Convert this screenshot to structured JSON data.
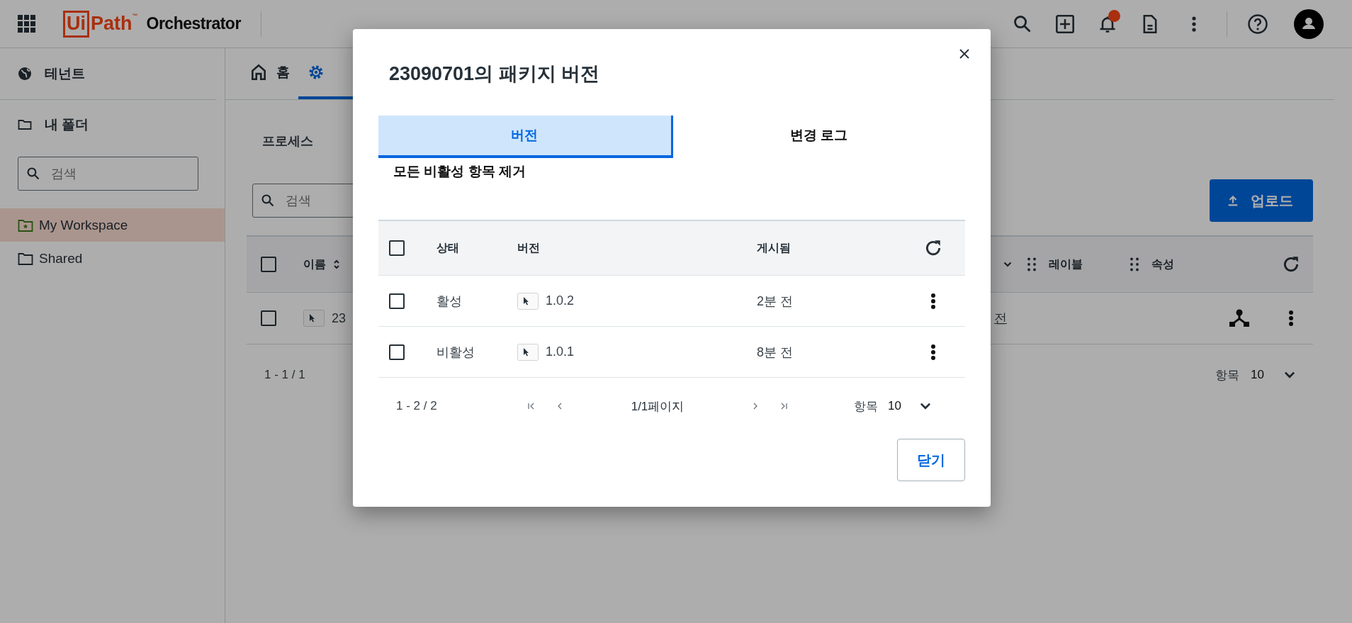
{
  "top_bar": {
    "logo": {
      "boxed": "Ui",
      "rest": "Path",
      "tm": "™"
    },
    "product": "Orchestrator",
    "notification_badge": true
  },
  "sidebar": {
    "tenant": "테넌트",
    "my_folder": "내 폴더",
    "search": {
      "placeholder": "검색"
    },
    "folders": [
      {
        "label": "My Workspace",
        "kind": "personal",
        "selected": true
      },
      {
        "label": "Shared",
        "kind": "folder",
        "selected": false
      }
    ]
  },
  "main": {
    "tabs": [
      {
        "kind": "home",
        "label": "홈",
        "selected": false
      },
      {
        "kind": "gear",
        "selected": true
      }
    ],
    "section": "프로세스",
    "search": {
      "placeholder": "검색"
    },
    "upload_button": "업로드",
    "table": {
      "header_checked": false,
      "columns": [
        {
          "kind": "sortable",
          "label": "이름"
        },
        {
          "kind": "dropdown"
        },
        {
          "kind": "draggable",
          "label": "레이블"
        },
        {
          "kind": "draggable",
          "label": "속성"
        }
      ],
      "rows": [
        {
          "checked": false,
          "name": "23",
          "column_2": "전"
        }
      ]
    },
    "pagination": {
      "range": "1 - 1 / 1",
      "items_label": "항목",
      "page_size": "10"
    }
  },
  "dialog": {
    "title": "23090701의 패키지 버전",
    "tabs": [
      {
        "label": "버전",
        "selected": true
      },
      {
        "label": "변경 로그",
        "selected": false
      }
    ],
    "remove_inactive": "모든 비활성 항목 제거",
    "table": {
      "header_checked": false,
      "columns": [
        "상태",
        "버전",
        "게시됨"
      ],
      "rows": [
        {
          "checked": false,
          "status": "활성",
          "version": "1.0.2",
          "published": "2분 전"
        },
        {
          "checked": false,
          "status": "비활성",
          "version": "1.0.1",
          "published": "8분 전"
        }
      ]
    },
    "pagination": {
      "range": "1 - 2 / 2",
      "page": "1/1페이지",
      "items_label": "항목",
      "page_size": "10"
    },
    "close_button": "닫기"
  }
}
